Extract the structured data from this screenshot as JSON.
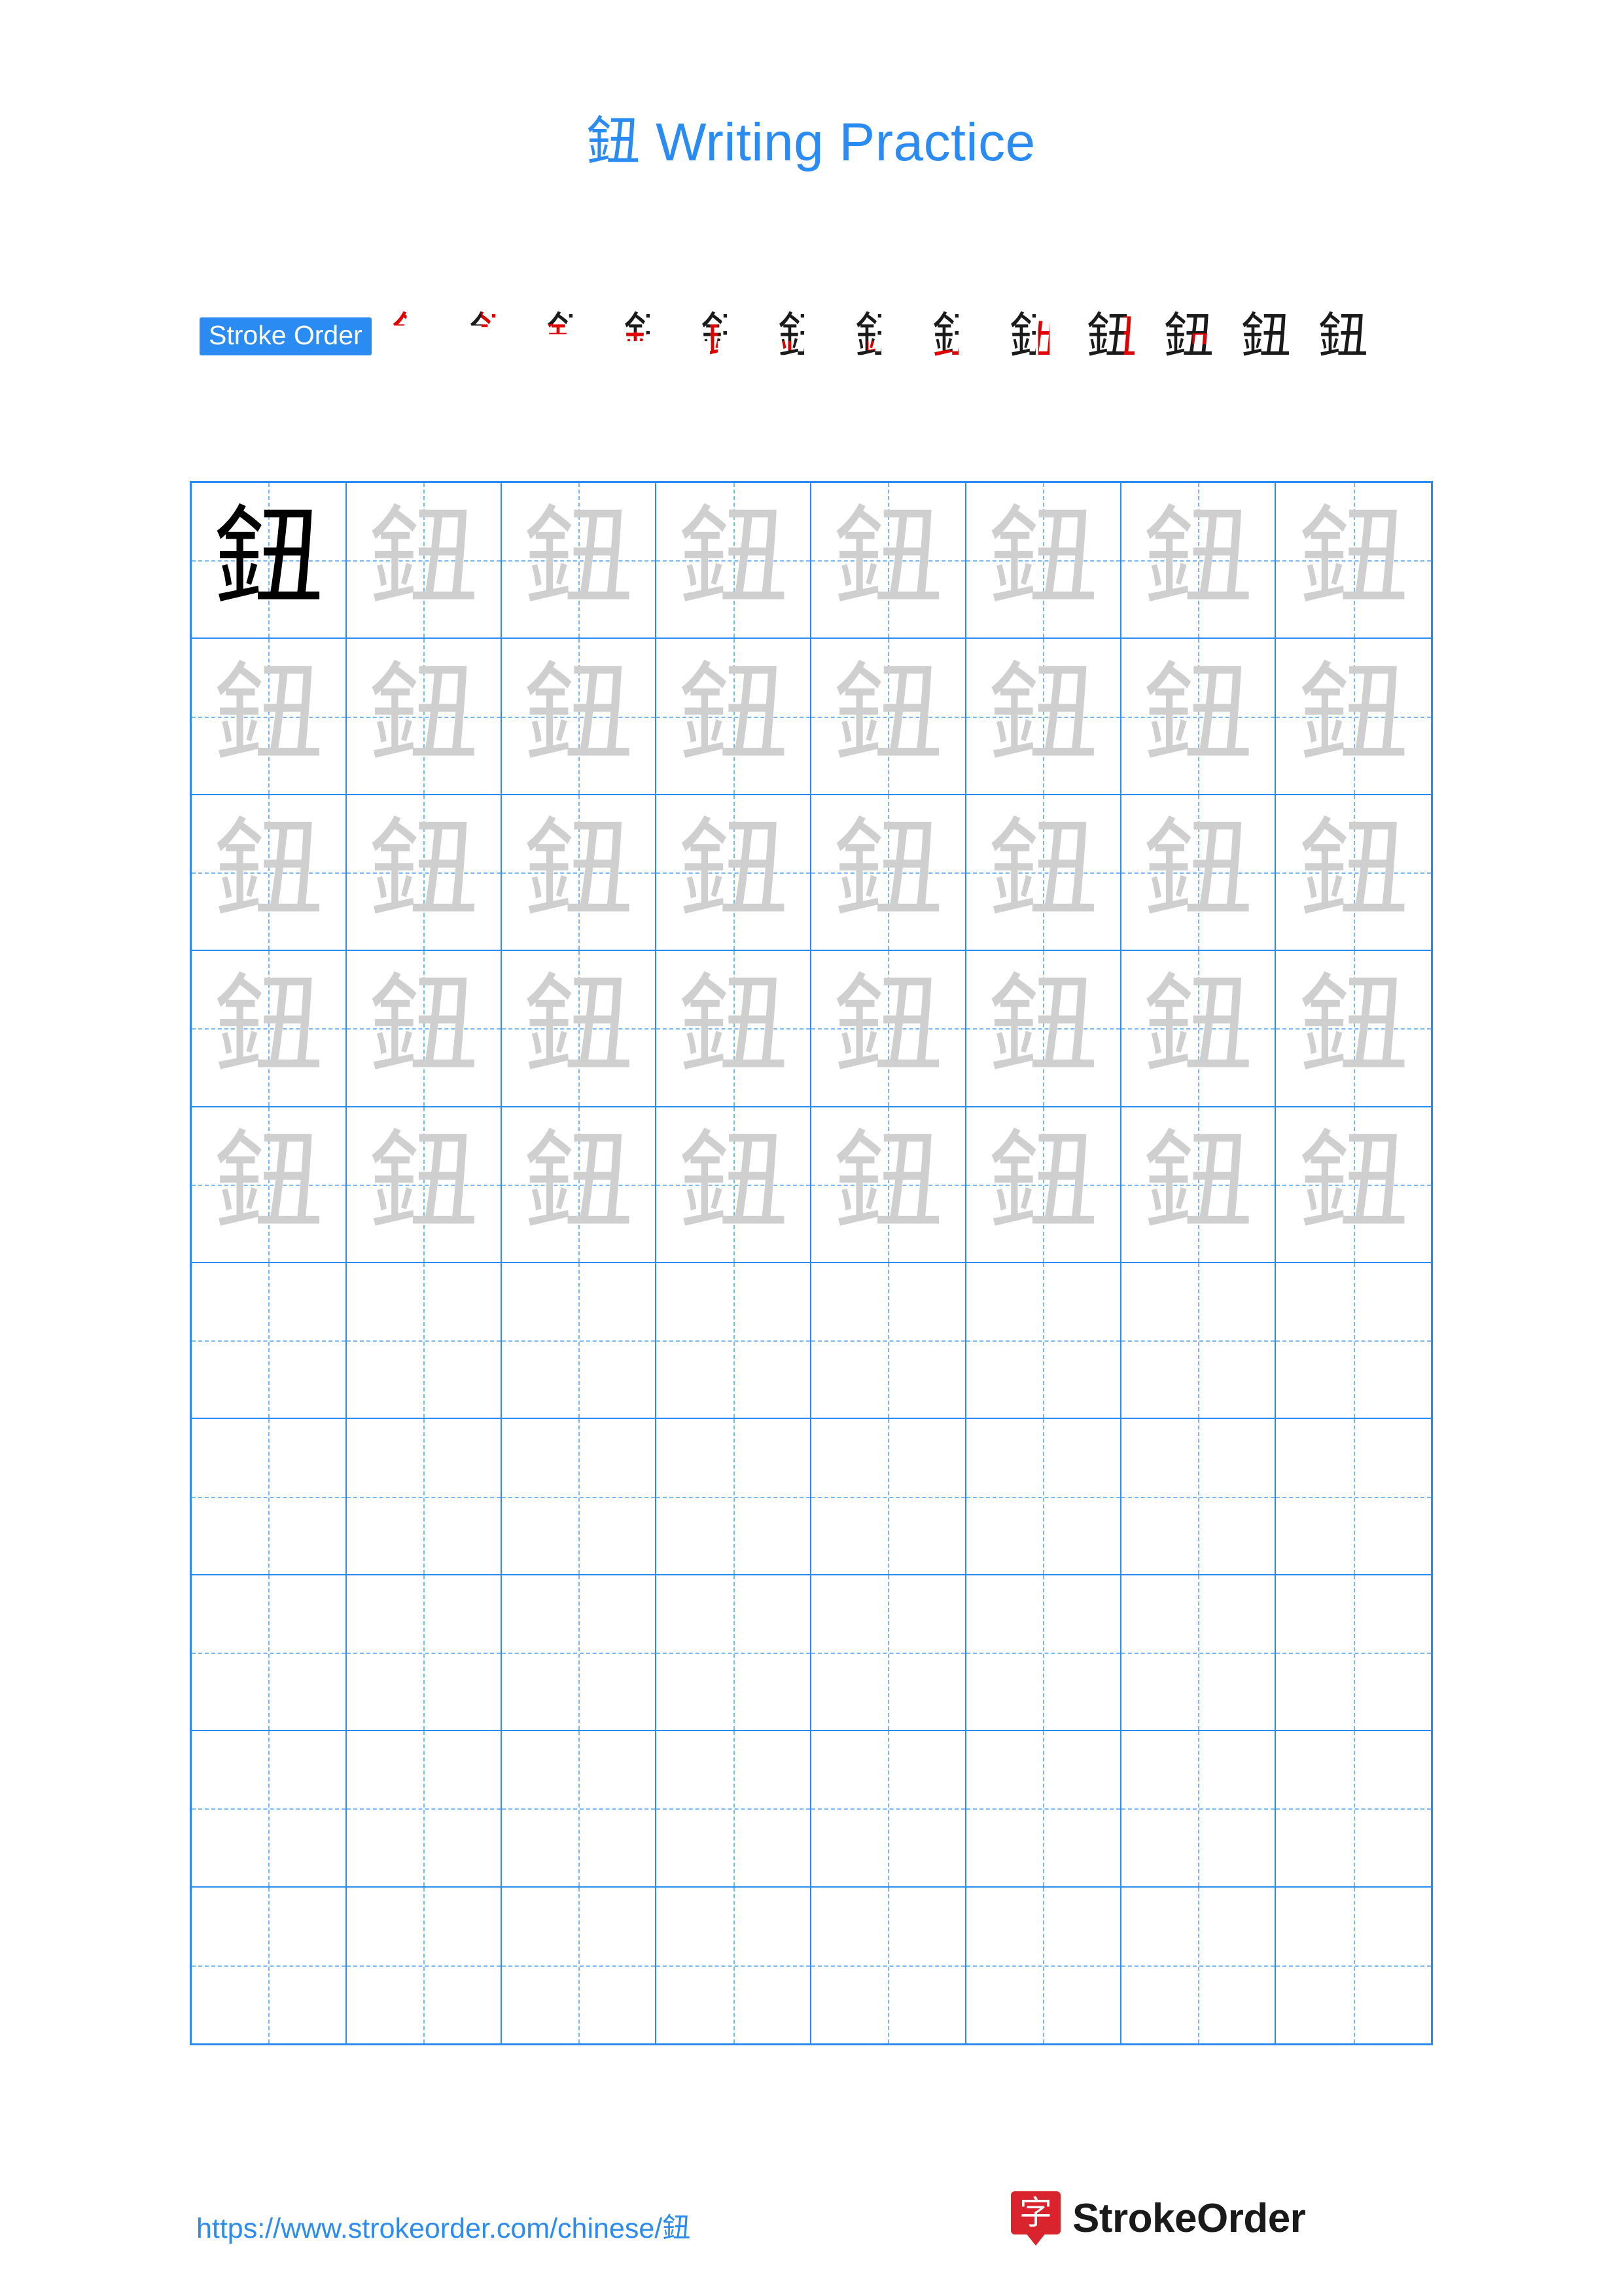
{
  "document": {
    "title_char": "鈕",
    "title_text": "Writing Practice",
    "character": "鈕"
  },
  "stroke_order": {
    "badge_label": "Stroke Order",
    "total_strokes": 12,
    "steps": [
      {
        "index": 1,
        "glyph": "鈕",
        "reveal": 1
      },
      {
        "index": 2,
        "glyph": "鈕",
        "reveal": 2
      },
      {
        "index": 3,
        "glyph": "鈕",
        "reveal": 3
      },
      {
        "index": 4,
        "glyph": "鈕",
        "reveal": 4
      },
      {
        "index": 5,
        "glyph": "鈕",
        "reveal": 5
      },
      {
        "index": 6,
        "glyph": "鈕",
        "reveal": 6
      },
      {
        "index": 7,
        "glyph": "鈕",
        "reveal": 7
      },
      {
        "index": 8,
        "glyph": "鈕",
        "reveal": 8
      },
      {
        "index": 9,
        "glyph": "鈕",
        "reveal": 9
      },
      {
        "index": 10,
        "glyph": "鈕",
        "reveal": 10
      },
      {
        "index": 11,
        "glyph": "鈕",
        "reveal": 11
      },
      {
        "index": 12,
        "glyph": "鈕",
        "reveal": 12
      },
      {
        "index": 13,
        "glyph": "鈕",
        "reveal": 13
      }
    ]
  },
  "practice_grid": {
    "columns": 8,
    "rows": 10,
    "traced_rows": 5,
    "blank_rows": 5,
    "first_cell_style": "solid",
    "trace_char": "鈕"
  },
  "footer": {
    "url": "https://www.strokeorder.com/chinese/鈕",
    "brand_mark": "字",
    "brand_name": "StrokeOrder"
  },
  "colors": {
    "accent": "#2a8bf2",
    "grid_line": "#2a8bf2",
    "grid_dash": "#7ab8f5",
    "trace_gray": "#cfcfcf",
    "stroke_red": "#e00000",
    "brand_red": "#d9232d"
  }
}
